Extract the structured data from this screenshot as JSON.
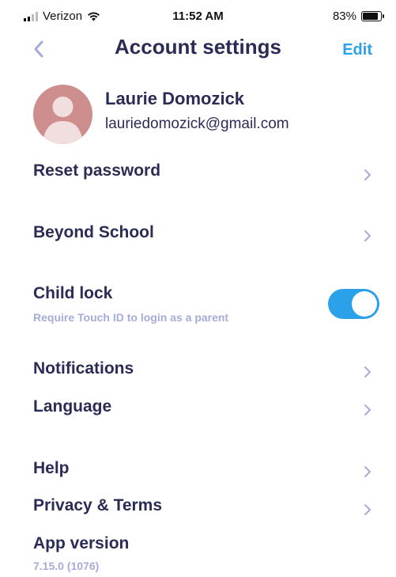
{
  "status_bar": {
    "carrier": "Verizon",
    "time": "11:52 AM",
    "battery": "83%"
  },
  "nav": {
    "title": "Account settings",
    "edit_label": "Edit"
  },
  "profile": {
    "name": "Laurie Domozick",
    "email": "lauriedomozick@gmail.com"
  },
  "rows": {
    "reset_password": "Reset password",
    "beyond_school": "Beyond School",
    "child_lock": "Child lock",
    "child_lock_sub": "Require Touch ID to login as a parent",
    "child_lock_enabled": true,
    "notifications": "Notifications",
    "language": "Language",
    "help": "Help",
    "privacy_terms": "Privacy & Terms",
    "app_version": "App version",
    "app_version_value": "7.15.0 (1076)"
  },
  "colors": {
    "text": "#2b2c55",
    "accent": "#2aa1e8",
    "subtext": "#a6acd8",
    "chevron": "#a6acd8"
  }
}
